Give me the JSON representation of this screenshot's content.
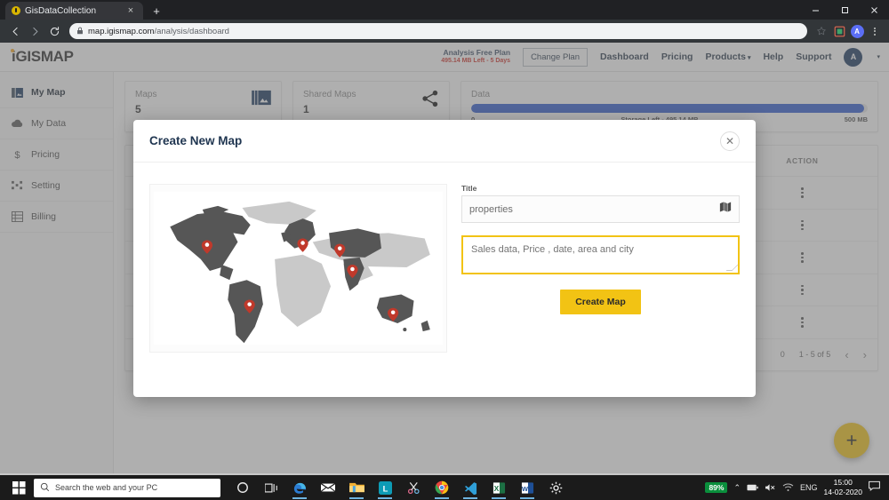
{
  "browser": {
    "tab_title": "GisDataCollection",
    "tab_close": "×",
    "new_tab": "+",
    "url_host": "map.igismap.com",
    "url_path": "/analysis/dashboard",
    "back_icon": "back-arrow-icon",
    "forward_icon": "forward-arrow-icon",
    "reload_icon": "reload-icon",
    "profile_initial": "A",
    "window": {
      "minimize": "–",
      "maximize": "□",
      "close": "✕"
    }
  },
  "appbar": {
    "logo": "GISMAP",
    "plan_title": "Analysis Free Plan",
    "plan_sub": "495.14 MB Left - 5 Days",
    "change_plan": "Change Plan",
    "links": [
      {
        "label": "Dashboard",
        "caret": false
      },
      {
        "label": "Pricing",
        "caret": false
      },
      {
        "label": "Products",
        "caret": true
      },
      {
        "label": "Help",
        "caret": false
      },
      {
        "label": "Support",
        "caret": false
      }
    ],
    "avatar_initial": "A",
    "avatar_caret": "▾"
  },
  "sidebar": {
    "items": [
      {
        "label": "My Map",
        "icon": "map-grid-icon",
        "active": true
      },
      {
        "label": "My Data",
        "icon": "cloud-icon",
        "active": false
      },
      {
        "label": "Pricing",
        "icon": "dollar-icon",
        "active": false
      },
      {
        "label": "Setting",
        "icon": "settings-sliders-icon",
        "active": false
      },
      {
        "label": "Billing",
        "icon": "table-icon",
        "active": false
      }
    ]
  },
  "cards": {
    "maps": {
      "label": "Maps",
      "value": "5",
      "icon": "map-book-icon"
    },
    "shared_maps": {
      "label": "Shared Maps",
      "value": "1",
      "icon": "share-icon"
    },
    "data": {
      "label": "Data",
      "bar_percent": 99,
      "min_label": "0",
      "mid_label": "Storage Left - 495.14 MB",
      "max_label": "500 MB",
      "bar_color": "#2f5bd0"
    }
  },
  "table": {
    "columns": [
      "ACTION"
    ],
    "rows": [
      {
        "action_icon": "more-vertical-icon"
      },
      {
        "action_icon": "more-vertical-icon"
      },
      {
        "action_icon": "more-vertical-icon"
      },
      {
        "action_icon": "more-vertical-icon"
      },
      {
        "action_icon": "more-vertical-icon"
      }
    ],
    "pager": {
      "rows_per_page": "0",
      "range": "1 - 5 of 5",
      "prev": "‹",
      "next": "›"
    }
  },
  "fab": {
    "label": "+",
    "icon": "add-icon",
    "color": "#f2c314"
  },
  "modal": {
    "title": "Create New Map",
    "close": "✕",
    "map_illustration": "world-map-illustration",
    "title_field": {
      "label": "Title",
      "value": "properties",
      "placeholder": "Title",
      "icon": "map-fold-icon"
    },
    "description_field": {
      "value": "",
      "placeholder": "Sales data, Price , date, area and city",
      "focused": true,
      "focus_color": "#f2c314"
    },
    "submit": "Create Map"
  },
  "taskbar": {
    "start_icon": "windows-start-icon",
    "search_placeholder": "Search the web and your PC",
    "search_icon": "search-icon",
    "icons": [
      {
        "name": "cortana-icon"
      },
      {
        "name": "task-view-icon"
      },
      {
        "name": "edge-icon"
      },
      {
        "name": "mail-icon"
      },
      {
        "name": "file-explorer-icon"
      },
      {
        "name": "lightroom-icon"
      },
      {
        "name": "snip-sketch-icon"
      },
      {
        "name": "chrome-icon"
      },
      {
        "name": "vs-code-icon"
      },
      {
        "name": "excel-icon"
      },
      {
        "name": "word-icon"
      },
      {
        "name": "settings-gear-icon"
      }
    ],
    "tray": {
      "battery": "89%",
      "chevron": "⌃",
      "language": "ENG",
      "time": "15:00",
      "date": "14-02-2020"
    }
  }
}
